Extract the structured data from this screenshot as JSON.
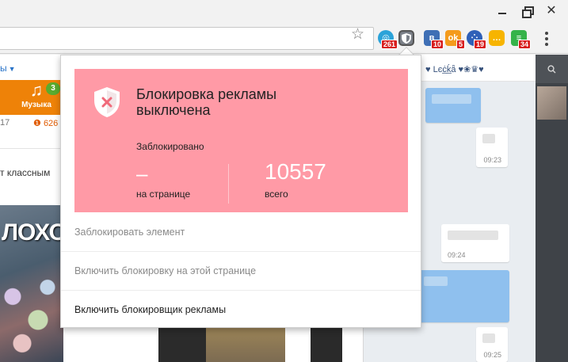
{
  "toolbar": {
    "extensions": [
      {
        "name": "extension-1",
        "badge": "261",
        "glyph": "◎"
      },
      {
        "name": "adblock-extension",
        "badge": "",
        "glyph": "✕"
      },
      {
        "name": "vk-extension",
        "badge": "10",
        "glyph": "в"
      },
      {
        "name": "ok-extension",
        "badge": "5",
        "glyph": "ok"
      },
      {
        "name": "extension-5",
        "badge": "19",
        "glyph": "⁘"
      },
      {
        "name": "extension-6",
        "badge": "",
        "glyph": "…"
      },
      {
        "name": "extension-7",
        "badge": "34",
        "glyph": "≡"
      }
    ]
  },
  "page": {
    "nav_link": "ы",
    "music_label": "Музыка",
    "music_badge": "3",
    "stat_1": "17",
    "stat_2": "626",
    "feed_text": "т классным",
    "photo_caption": "ЛОХО",
    "chat_header_name": "♥ Lєċ̲ḱ̲ǟ ♥❀♛♥",
    "chat_times": [
      "09:23",
      "09:24",
      "09:25"
    ]
  },
  "popup": {
    "title": "Блокировка рекламы выключена",
    "blocked_label": "Заблокировано",
    "page_count": "–",
    "page_label": "на странице",
    "total_count": "10557",
    "total_label": "всего",
    "menu": [
      {
        "label": "Заблокировать элемент",
        "enabled": false
      },
      {
        "label": "Включить блокировку на этой странице",
        "enabled": false
      },
      {
        "label": "Включить блокировщик рекламы",
        "enabled": true
      }
    ],
    "colors": {
      "status_bg": "#ff9aa6",
      "count_text": "#ffffff"
    }
  }
}
